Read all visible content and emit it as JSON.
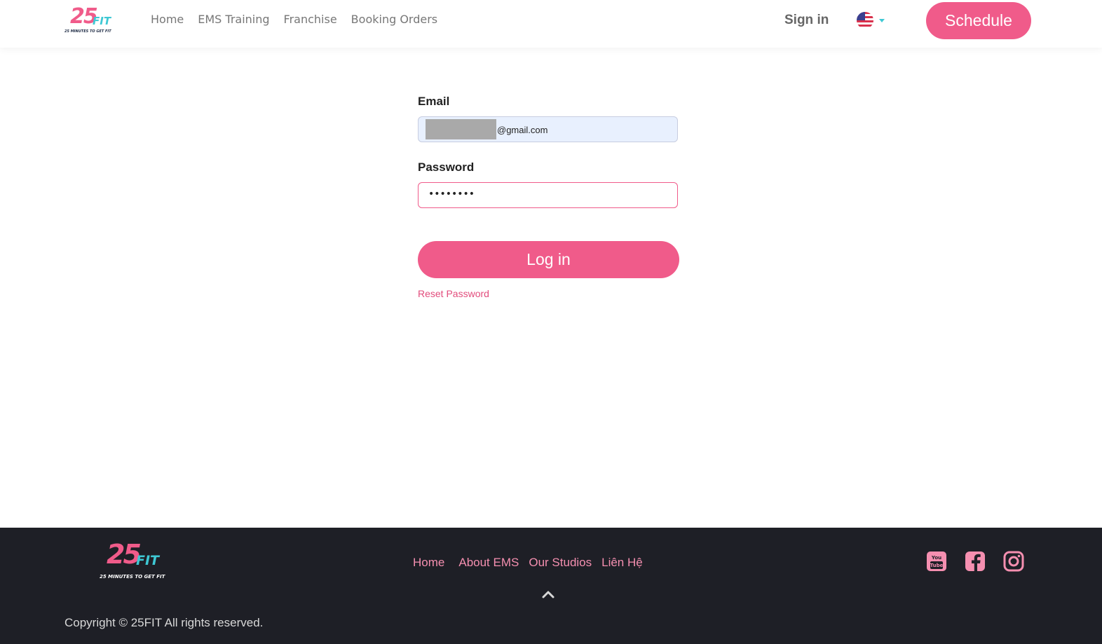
{
  "header": {
    "logo": {
      "number": "25",
      "mark": "'",
      "word": "FIT",
      "tagline": "25 MINUTES TO GET FIT"
    },
    "nav": [
      "Home",
      "EMS Training",
      "Franchise",
      "Booking Orders"
    ],
    "sign_in": "Sign in",
    "language_icon": "us-flag-icon",
    "schedule": "Schedule"
  },
  "form": {
    "email_label": "Email",
    "email_value_visible": "@gmail.com",
    "password_label": "Password",
    "password_value": "••••••••",
    "login_label": "Log in",
    "reset_label": "Reset Password"
  },
  "footer": {
    "logo": {
      "number": "25",
      "mark": "'",
      "word": "FIT",
      "tagline": "25 MINUTES TO GET FIT"
    },
    "nav": [
      "Home",
      "About EMS",
      "Our Studios",
      "Liên Hệ"
    ],
    "copyright": "Copyright © 25FIT All rights reserved.",
    "social": [
      "youtube-icon",
      "facebook-icon",
      "instagram-icon"
    ]
  },
  "colors": {
    "accent": "#f05b8a",
    "teal": "#3ec8d4",
    "footer_bg": "#1e1f26",
    "footer_link": "#f58fb0"
  }
}
